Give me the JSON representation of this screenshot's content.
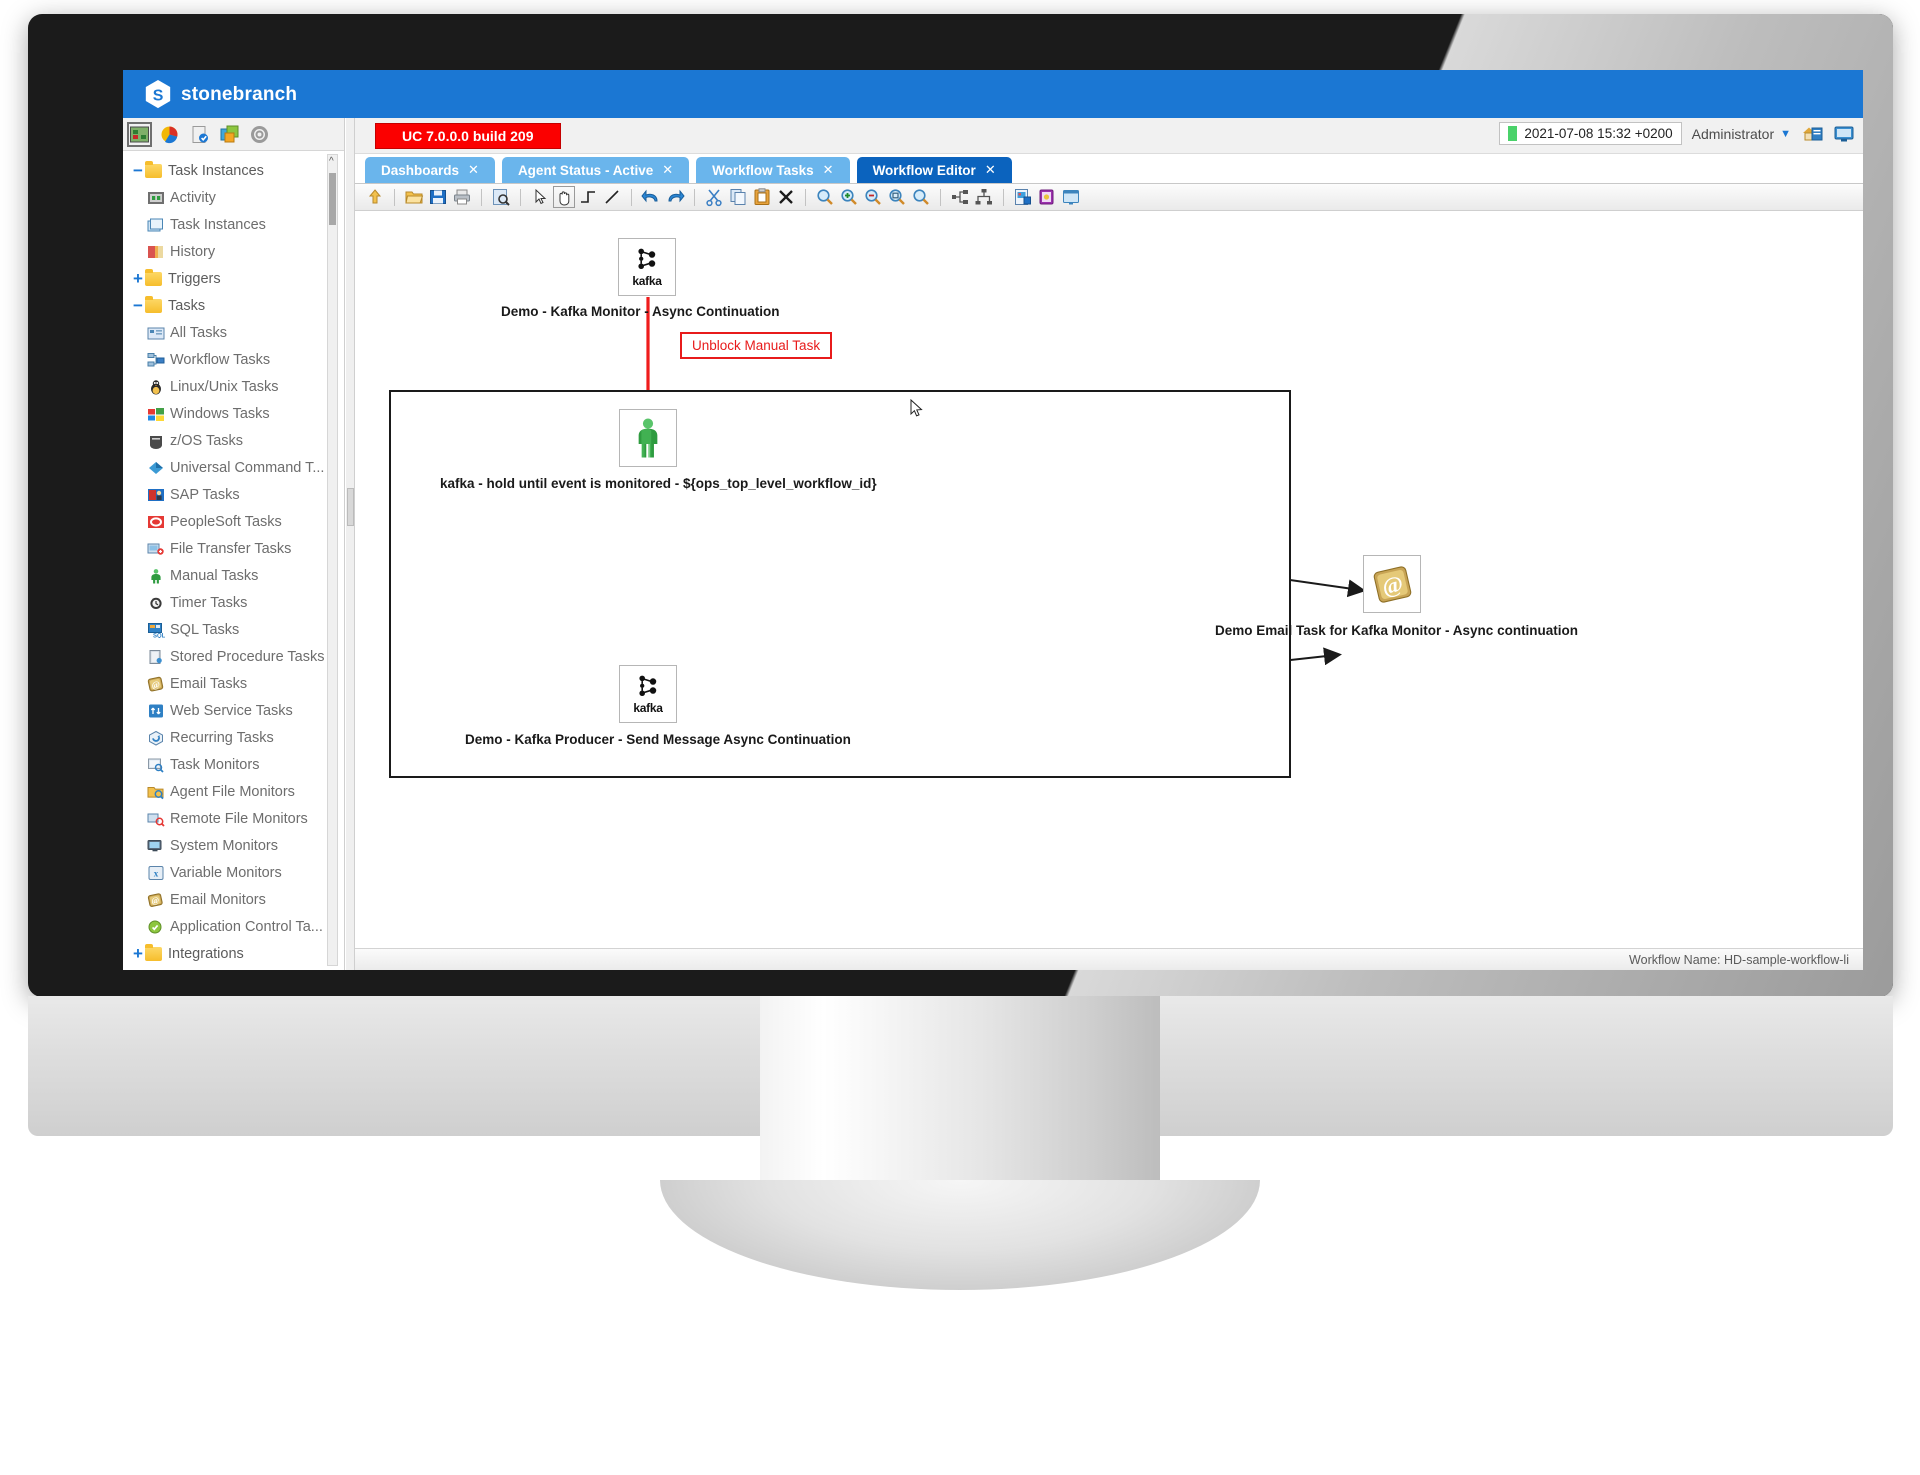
{
  "app": {
    "brand": "stonebranch",
    "logo_icon": "stonebranch-hex-logo"
  },
  "left_toolbar": {
    "items": [
      {
        "name": "automation-center-icon",
        "label": "Automation Center",
        "selected": true
      },
      {
        "name": "reporting-icon",
        "label": "Reporting"
      },
      {
        "name": "bundles-and-promotion-icon",
        "label": "Bundles and Promotion"
      },
      {
        "name": "services-icon",
        "label": "Services"
      },
      {
        "name": "administration-gear-icon",
        "label": "Administration"
      }
    ]
  },
  "sidebar": {
    "scroll_up_icon": "chevron-up-icon",
    "items": [
      {
        "label": "Task Instances",
        "type": "folder",
        "toggle": "−",
        "icon": "folder-icon"
      },
      {
        "label": "Activity",
        "type": "leaf",
        "icon": "activity-icon"
      },
      {
        "label": "Task Instances",
        "type": "leaf",
        "icon": "task-instances-icon"
      },
      {
        "label": "History",
        "type": "leaf",
        "icon": "history-book-icon"
      },
      {
        "label": "Triggers",
        "type": "folder",
        "toggle": "+",
        "icon": "folder-icon"
      },
      {
        "label": "Tasks",
        "type": "folder",
        "toggle": "−",
        "icon": "folder-icon"
      },
      {
        "label": "All Tasks",
        "type": "leaf",
        "icon": "all-tasks-icon"
      },
      {
        "label": "Workflow Tasks",
        "type": "leaf",
        "icon": "workflow-tasks-icon"
      },
      {
        "label": "Linux/Unix Tasks",
        "type": "leaf",
        "icon": "linux-penguin-icon"
      },
      {
        "label": "Windows Tasks",
        "type": "leaf",
        "icon": "windows-logo-icon"
      },
      {
        "label": "z/OS Tasks",
        "type": "leaf",
        "icon": "zos-mainframe-icon"
      },
      {
        "label": "Universal Command T...",
        "type": "leaf",
        "icon": "universal-command-icon"
      },
      {
        "label": "SAP Tasks",
        "type": "leaf",
        "icon": "sap-icon"
      },
      {
        "label": "PeopleSoft Tasks",
        "type": "leaf",
        "icon": "peoplesoft-icon"
      },
      {
        "label": "File Transfer Tasks",
        "type": "leaf",
        "icon": "file-transfer-icon"
      },
      {
        "label": "Manual Tasks",
        "type": "leaf",
        "icon": "manual-person-icon"
      },
      {
        "label": "Timer Tasks",
        "type": "leaf",
        "icon": "timer-clock-icon"
      },
      {
        "label": "SQL Tasks",
        "type": "leaf",
        "icon": "sql-icon"
      },
      {
        "label": "Stored Procedure Tasks",
        "type": "leaf",
        "icon": "stored-procedure-icon"
      },
      {
        "label": "Email Tasks",
        "type": "leaf",
        "icon": "email-at-icon"
      },
      {
        "label": "Web Service Tasks",
        "type": "leaf",
        "icon": "web-service-icon"
      },
      {
        "label": "Recurring Tasks",
        "type": "leaf",
        "icon": "recurring-icon"
      },
      {
        "label": "Task Monitors",
        "type": "leaf",
        "icon": "task-monitor-icon"
      },
      {
        "label": "Agent File Monitors",
        "type": "leaf",
        "icon": "agent-file-monitor-icon"
      },
      {
        "label": "Remote File Monitors",
        "type": "leaf",
        "icon": "remote-file-monitor-icon"
      },
      {
        "label": "System Monitors",
        "type": "leaf",
        "icon": "system-monitor-icon"
      },
      {
        "label": "Variable Monitors",
        "type": "leaf",
        "icon": "variable-monitor-icon"
      },
      {
        "label": "Email Monitors",
        "type": "leaf",
        "icon": "email-monitor-icon"
      },
      {
        "label": "Application Control Ta...",
        "type": "leaf",
        "icon": "application-control-icon"
      },
      {
        "label": "Integrations",
        "type": "folder",
        "toggle": "+",
        "icon": "folder-icon"
      }
    ]
  },
  "topbar": {
    "build_badge": "UC 7.0.0.0 build 209",
    "clock": "2021-07-08 15:32 +0200",
    "user": "Administrator",
    "user_caret": "▼",
    "icons": [
      {
        "name": "home-page-icon"
      },
      {
        "name": "console-icon"
      }
    ]
  },
  "tabs": [
    {
      "label": "Dashboards",
      "close": "✕",
      "active": false
    },
    {
      "label": "Agent Status - Active",
      "close": "✕",
      "active": false
    },
    {
      "label": "Workflow Tasks",
      "close": "✕",
      "active": false
    },
    {
      "label": "Workflow Editor",
      "close": "✕",
      "active": true
    }
  ],
  "editor_toolbar": {
    "groups": [
      [
        {
          "name": "go-up-level-icon",
          "title": "Go Up One Level"
        }
      ],
      [
        {
          "name": "open-folder-icon",
          "title": "Open"
        },
        {
          "name": "save-icon",
          "title": "Save"
        },
        {
          "name": "print-icon",
          "title": "Print"
        }
      ],
      [
        {
          "name": "find-task-icon",
          "title": "Find"
        }
      ],
      [
        {
          "name": "select-pointer-icon",
          "title": "Select",
          "framed": false
        },
        {
          "name": "pan-hand-icon",
          "title": "Pan",
          "framed": true
        },
        {
          "name": "connector-elbow-icon",
          "title": "Elbow Connector"
        },
        {
          "name": "connector-straight-icon",
          "title": "Straight Connector"
        }
      ],
      [
        {
          "name": "undo-icon",
          "title": "Undo"
        },
        {
          "name": "redo-icon",
          "title": "Redo"
        }
      ],
      [
        {
          "name": "cut-scissors-icon",
          "title": "Cut"
        },
        {
          "name": "copy-icon",
          "title": "Copy"
        },
        {
          "name": "paste-clipboard-icon",
          "title": "Paste"
        },
        {
          "name": "delete-x-icon",
          "title": "Delete"
        }
      ],
      [
        {
          "name": "zoom-reset-icon",
          "title": "Zoom Reset"
        },
        {
          "name": "zoom-in-icon",
          "title": "Zoom In"
        },
        {
          "name": "zoom-out-icon",
          "title": "Zoom Out"
        },
        {
          "name": "zoom-fit-icon",
          "title": "Zoom To Fit"
        },
        {
          "name": "zoom-selection-icon",
          "title": "Zoom Selection"
        }
      ],
      [
        {
          "name": "align-layout-icon",
          "title": "Align"
        },
        {
          "name": "hierarchy-layout-icon",
          "title": "Auto Layout"
        }
      ],
      [
        {
          "name": "export-image-icon",
          "title": "Export Image"
        },
        {
          "name": "documentation-icon",
          "title": "Documentation"
        },
        {
          "name": "properties-panel-icon",
          "title": "Properties"
        }
      ]
    ]
  },
  "workflow": {
    "footer_text": "Workflow Name: HD-sample-workflow-li",
    "annotation": "Unblock Manual Task",
    "cursor_icon": "mouse-pointer-cursor",
    "nodes": [
      {
        "id": "kafka-monitor",
        "icon": "kafka-logo-icon",
        "icon_word": "kafka",
        "label": "Demo - Kafka Monitor - Async Continuation"
      },
      {
        "id": "manual-hold",
        "icon": "manual-task-person-icon",
        "label": "kafka - hold until event is monitored - ${ops_top_level_workflow_id}"
      },
      {
        "id": "email-task",
        "icon": "email-at-task-icon",
        "label": "Demo Email Task for Kafka Monitor - Async continuation"
      },
      {
        "id": "kafka-producer",
        "icon": "kafka-logo-icon",
        "icon_word": "kafka",
        "label": "Demo - Kafka Producer - Send Message Async Continuation"
      }
    ],
    "edges": [
      {
        "from": "kafka-monitor",
        "to": "manual-hold",
        "color": "#ef1c1c"
      },
      {
        "from": "manual-hold",
        "to": "email-task",
        "color": "#1a1a1a"
      },
      {
        "from": "kafka-producer",
        "to": "email-task",
        "color": "#1a1a1a"
      }
    ]
  },
  "colors": {
    "brand_blue": "#1b77d3",
    "tab_active": "#0b63be",
    "tab_inactive": "#6ab5ec",
    "badge_red": "#fb0000",
    "annotation_red": "#e81b1b",
    "manual_green": "#2e9b3f"
  }
}
